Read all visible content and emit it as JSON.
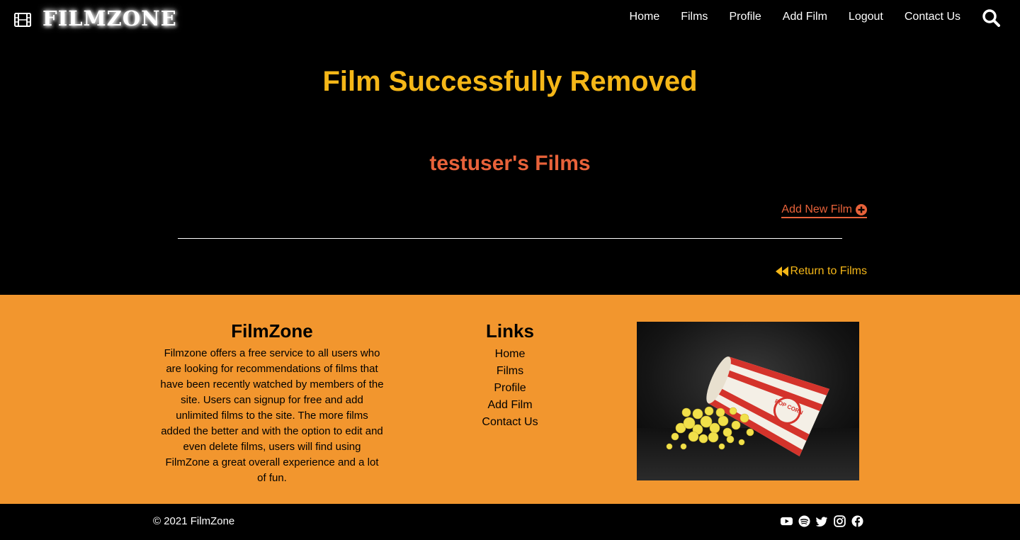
{
  "navbar": {
    "brand": "FILMZONE",
    "brand_icon": "film-icon",
    "links": [
      "Home",
      "Films",
      "Profile",
      "Add Film",
      "Logout",
      "Contact Us"
    ],
    "search_icon": "search-icon"
  },
  "main": {
    "flash_message": "Film Successfully Removed",
    "section_title": "testuser's Films",
    "add_film_label": "Add New Film",
    "add_film_icon": "plus-circle-icon",
    "return_label": "Return to Films",
    "return_icon": "rewind-icon"
  },
  "footer": {
    "about": {
      "heading": "FilmZone",
      "text": "Filmzone offers a free service to all users who are looking for recommendations of films that have been recently watched by members of the site. Users can signup for free and add unlimited films to the site. The more films added the better and with the option to edit and even delete films, users will find using FilmZone a great overall experience and a lot of fun."
    },
    "links": {
      "heading": "Links",
      "items": [
        "Home",
        "Films",
        "Profile",
        "Add Film",
        "Contact Us"
      ]
    },
    "image_alt": "popcorn box spilling popcorn",
    "image_text": "POP CORN"
  },
  "bottom_bar": {
    "copyright": "© 2021 FilmZone",
    "socials": [
      "youtube-icon",
      "spotify-icon",
      "twitter-icon",
      "instagram-icon",
      "facebook-icon"
    ]
  },
  "colors": {
    "background": "#000000",
    "flash": "#f5b718",
    "accent": "#e8623a",
    "footer": "#f2962e"
  }
}
